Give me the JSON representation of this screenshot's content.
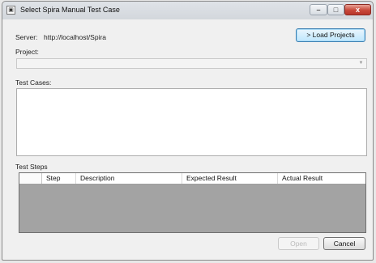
{
  "window": {
    "title": "Select Spira Manual Test Case",
    "app_icon": "test-case-app-icon",
    "controls": {
      "minimize": "–",
      "maximize": "□",
      "close": "x"
    }
  },
  "server": {
    "label": "Server:",
    "value": "http://localhost/Spira"
  },
  "load_projects_label": "> Load Projects",
  "project": {
    "label": "Project:",
    "selected": ""
  },
  "test_cases": {
    "label": "Test Cases:"
  },
  "test_steps": {
    "label": "Test Steps",
    "columns": [
      "Step",
      "Description",
      "Expected Result",
      "Actual Result"
    ]
  },
  "buttons": {
    "open": "Open",
    "cancel": "Cancel"
  },
  "colors": {
    "grid_background": "#a3a3a3",
    "close_button": "#c9493a"
  }
}
